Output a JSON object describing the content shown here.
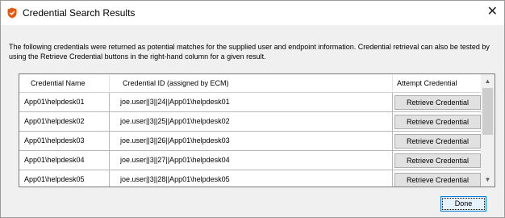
{
  "window": {
    "title": "Credential Search Results",
    "icon": "shield-app-icon",
    "close_glyph": "✕"
  },
  "intro_text": "The following credentials were returned as potential matches for the supplied user and endpoint information.  Credential retrieval can also be tested by using the Retrieve Credential buttons in the right-hand column for a given result.",
  "table": {
    "headers": [
      "Credential Name",
      "Credential ID (assigned by ECM)",
      "Attempt Credential Retrieval"
    ],
    "rows": [
      {
        "name": "App01\\helpdesk01",
        "id": "joe.user||3||24||App01\\helpdesk01",
        "button": "Retrieve Credential"
      },
      {
        "name": "App01\\helpdesk02",
        "id": "joe.user||3||25||App01\\helpdesk02",
        "button": "Retrieve Credential"
      },
      {
        "name": "App01\\helpdesk03",
        "id": "joe.user||3||26||App01\\helpdesk03",
        "button": "Retrieve Credential"
      },
      {
        "name": "App01\\helpdesk04",
        "id": "joe.user||3||27||App01\\helpdesk04",
        "button": "Retrieve Credential"
      },
      {
        "name": "App01\\helpdesk05",
        "id": "joe.user||3||28||App01\\helpdesk05",
        "button": "Retrieve Credential"
      }
    ],
    "scroll_up_glyph": "▲",
    "scroll_down_glyph": "▼"
  },
  "done_label": "Done",
  "colors": {
    "accent": "#0078d7",
    "icon_orange": "#e8590c"
  }
}
